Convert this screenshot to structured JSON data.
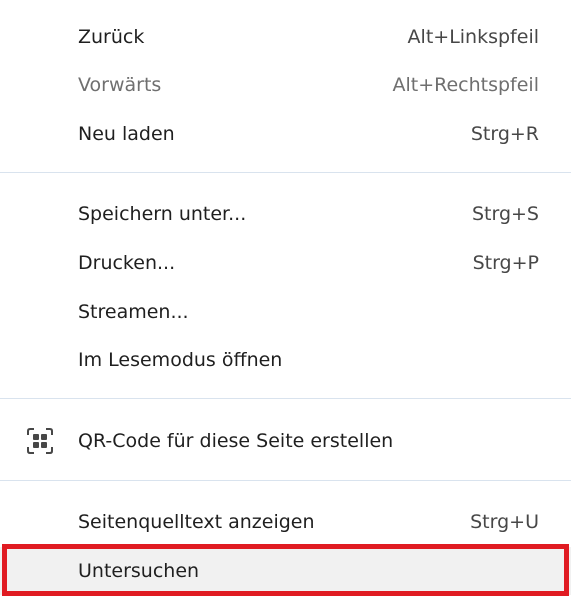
{
  "menu": {
    "items": [
      {
        "label": "Zurück",
        "shortcut": "Alt+Linkspfeil"
      },
      {
        "label": "Vorwärts",
        "shortcut": "Alt+Rechtspfeil"
      },
      {
        "label": "Neu laden",
        "shortcut": "Strg+R"
      },
      {
        "label": "Speichern unter...",
        "shortcut": "Strg+S"
      },
      {
        "label": "Drucken...",
        "shortcut": "Strg+P"
      },
      {
        "label": "Streamen...",
        "shortcut": ""
      },
      {
        "label": "Im Lesemodus öffnen",
        "shortcut": ""
      },
      {
        "label": "QR-Code für diese Seite erstellen",
        "shortcut": "",
        "icon": "qr-code-icon"
      },
      {
        "label": "Seitenquelltext anzeigen",
        "shortcut": "Strg+U"
      },
      {
        "label": "Untersuchen",
        "shortcut": ""
      }
    ],
    "disabled_item": "Vorwärts",
    "highlighted_item": "Untersuchen",
    "highlight_color": "#e01b22"
  }
}
